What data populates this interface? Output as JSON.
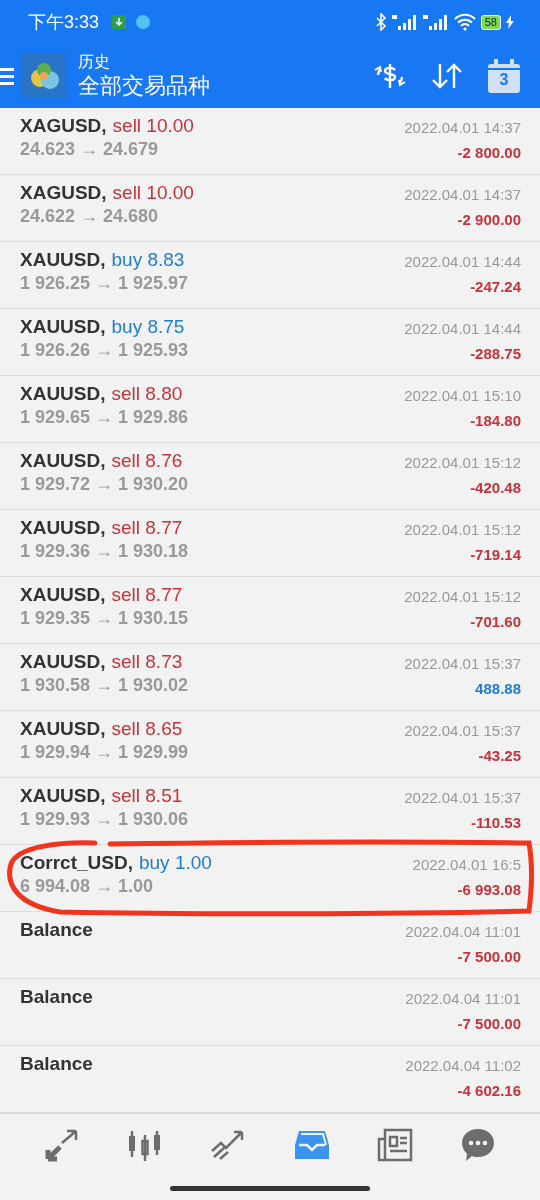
{
  "status_bar": {
    "time": "下午3:33",
    "battery": "58"
  },
  "header": {
    "title": "历史",
    "subtitle": "全部交易品种",
    "calendar_day": "3"
  },
  "rows": [
    {
      "kind": "sell",
      "symbol": "XAGUSD,",
      "order": "sell 10.00",
      "prices": "24.623 → 24.679",
      "time": "2022.04.01 14:37",
      "profit": "-2 800.00",
      "loss": true
    },
    {
      "kind": "sell",
      "symbol": "XAGUSD,",
      "order": "sell 10.00",
      "prices": "24.622 → 24.680",
      "time": "2022.04.01 14:37",
      "profit": "-2 900.00",
      "loss": true
    },
    {
      "kind": "buy",
      "symbol": "XAUUSD,",
      "order": "buy 8.83",
      "prices": "1 926.25 → 1 925.97",
      "time": "2022.04.01 14:44",
      "profit": "-247.24",
      "loss": true
    },
    {
      "kind": "buy",
      "symbol": "XAUUSD,",
      "order": "buy 8.75",
      "prices": "1 926.26 → 1 925.93",
      "time": "2022.04.01 14:44",
      "profit": "-288.75",
      "loss": true
    },
    {
      "kind": "sell",
      "symbol": "XAUUSD,",
      "order": "sell 8.80",
      "prices": "1 929.65 → 1 929.86",
      "time": "2022.04.01 15:10",
      "profit": "-184.80",
      "loss": true
    },
    {
      "kind": "sell",
      "symbol": "XAUUSD,",
      "order": "sell 8.76",
      "prices": "1 929.72 → 1 930.20",
      "time": "2022.04.01 15:12",
      "profit": "-420.48",
      "loss": true
    },
    {
      "kind": "sell",
      "symbol": "XAUUSD,",
      "order": "sell 8.77",
      "prices": "1 929.36 → 1 930.18",
      "time": "2022.04.01 15:12",
      "profit": "-719.14",
      "loss": true
    },
    {
      "kind": "sell",
      "symbol": "XAUUSD,",
      "order": "sell 8.77",
      "prices": "1 929.35 → 1 930.15",
      "time": "2022.04.01 15:12",
      "profit": "-701.60",
      "loss": true
    },
    {
      "kind": "sell",
      "symbol": "XAUUSD,",
      "order": "sell 8.73",
      "prices": "1 930.58 → 1 930.02",
      "time": "2022.04.01 15:37",
      "profit": "488.88",
      "loss": false
    },
    {
      "kind": "sell",
      "symbol": "XAUUSD,",
      "order": "sell 8.65",
      "prices": "1 929.94 → 1 929.99",
      "time": "2022.04.01 15:37",
      "profit": "-43.25",
      "loss": true
    },
    {
      "kind": "sell",
      "symbol": "XAUUSD,",
      "order": "sell 8.51",
      "prices": "1 929.93 → 1 930.06",
      "time": "2022.04.01 15:37",
      "profit": "-110.53",
      "loss": true
    },
    {
      "kind": "buy",
      "symbol": "Corrct_USD,",
      "order": "buy 1.00",
      "prices": "6 994.08 → 1.00",
      "time": "2022.04.01 16:5",
      "profit": "-6 993.08",
      "loss": true
    },
    {
      "kind": "balance",
      "symbol": "Balance",
      "time": "2022.04.04 11:01",
      "profit": "-7 500.00",
      "loss": true
    },
    {
      "kind": "balance",
      "symbol": "Balance",
      "time": "2022.04.04 11:01",
      "profit": "-7 500.00",
      "loss": true
    },
    {
      "kind": "balance",
      "symbol": "Balance",
      "time": "2022.04.04 11:02",
      "profit": "-4 602.16",
      "loss": true
    }
  ],
  "nav": [
    {
      "kind": "trade",
      "selected": false
    },
    {
      "kind": "quotes",
      "selected": false
    },
    {
      "kind": "chart",
      "selected": false
    },
    {
      "kind": "history",
      "selected": true
    },
    {
      "kind": "news",
      "selected": false
    },
    {
      "kind": "chat",
      "selected": false
    }
  ]
}
